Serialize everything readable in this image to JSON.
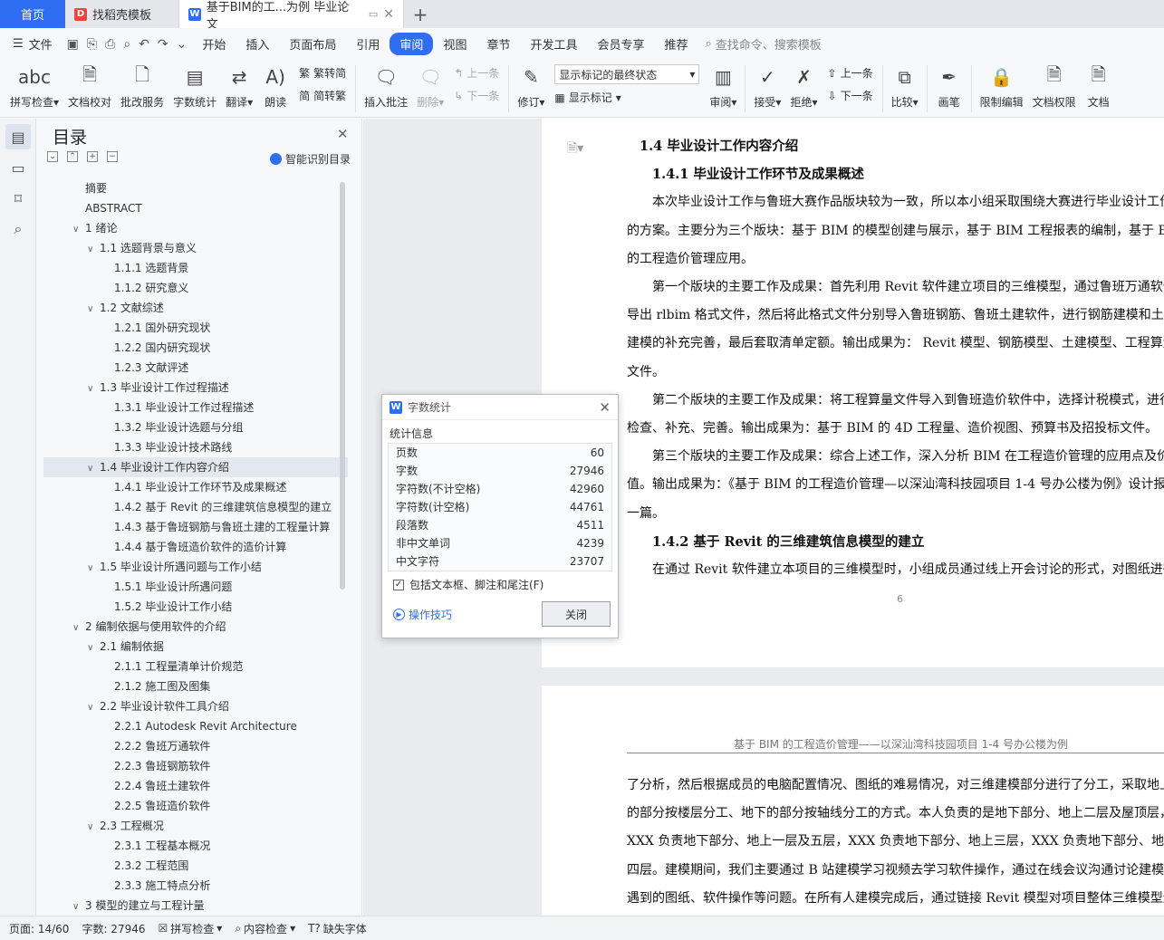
{
  "tabs": {
    "home": "首页",
    "template": "找稻壳模板",
    "doc": "基于BIM的工...为例 毕业论文"
  },
  "menu": {
    "file": "文件",
    "items": [
      "开始",
      "插入",
      "页面布局",
      "引用",
      "审阅",
      "视图",
      "章节",
      "开发工具",
      "会员专享",
      "推荐"
    ],
    "active_index": 4,
    "search": "查找命令、搜索模板"
  },
  "ribbon": {
    "spell": "拼写检查",
    "proofread": "文档校对",
    "batch": "批改服务",
    "wordcount": "字数统计",
    "translate": "翻译",
    "read": "朗读",
    "t2s": "繁转简",
    "s2t": "简转繁",
    "insert_comment": "插入批注",
    "delete": "删除",
    "prev": "上一条",
    "next": "下一条",
    "revise": "修订",
    "markup_select": "显示标记的最终状态",
    "show_markup": "显示标记",
    "review": "审阅",
    "accept": "接受",
    "reject": "拒绝",
    "prev2": "上一条",
    "next2": "下一条",
    "compare": "比较",
    "pen": "画笔",
    "restrict": "限制编辑",
    "perm": "文档权限",
    "more": "文档"
  },
  "toc": {
    "title": "目录",
    "smart": "智能识别目录",
    "items": [
      {
        "text": "摘要",
        "level": 0,
        "caret": ""
      },
      {
        "text": "ABSTRACT",
        "level": 0,
        "caret": ""
      },
      {
        "text": "1 绪论",
        "level": 0,
        "caret": "v"
      },
      {
        "text": "1.1 选题背景与意义",
        "level": 1,
        "caret": "v"
      },
      {
        "text": "1.1.1 选题背景",
        "level": 2,
        "caret": ""
      },
      {
        "text": "1.1.2 研究意义",
        "level": 2,
        "caret": ""
      },
      {
        "text": "1.2 文献综述",
        "level": 1,
        "caret": "v"
      },
      {
        "text": "1.2.1  国外研究现状",
        "level": 2,
        "caret": ""
      },
      {
        "text": "1.2.2  国内研究现状",
        "level": 2,
        "caret": ""
      },
      {
        "text": "1.2.3  文献评述",
        "level": 2,
        "caret": ""
      },
      {
        "text": "1.3 毕业设计工作过程描述",
        "level": 1,
        "caret": "v"
      },
      {
        "text": "1.3.1 毕业设计工作过程描述",
        "level": 2,
        "caret": ""
      },
      {
        "text": "1.3.2 毕业设计选题与分组",
        "level": 2,
        "caret": ""
      },
      {
        "text": "1.3.3 毕业设计技术路线",
        "level": 2,
        "caret": ""
      },
      {
        "text": "1.4 毕业设计工作内容介绍",
        "level": 1,
        "caret": "v",
        "selected": true
      },
      {
        "text": "1.4.1 毕业设计工作环节及成果概述",
        "level": 2,
        "caret": ""
      },
      {
        "text": "1.4.2 基于 Revit 的三维建筑信息模型的建立",
        "level": 2,
        "caret": ""
      },
      {
        "text": "1.4.3 基于鲁班钢筋与鲁班土建的工程量计算",
        "level": 2,
        "caret": ""
      },
      {
        "text": "1.4.4 基于鲁班造价软件的造价计算",
        "level": 2,
        "caret": ""
      },
      {
        "text": "1.5 毕业设计所遇问题与工作小结",
        "level": 1,
        "caret": "v"
      },
      {
        "text": "1.5.1 毕业设计所遇问题",
        "level": 2,
        "caret": ""
      },
      {
        "text": "1.5.2 毕业设计工作小结",
        "level": 2,
        "caret": ""
      },
      {
        "text": "2 编制依据与使用软件的介绍",
        "level": 0,
        "caret": "v"
      },
      {
        "text": "2.1 编制依据",
        "level": 1,
        "caret": "v"
      },
      {
        "text": "2.1.1 工程量清单计价规范",
        "level": 2,
        "caret": ""
      },
      {
        "text": "2.1.2 施工图及图集",
        "level": 2,
        "caret": ""
      },
      {
        "text": "2.2 毕业设计软件工具介绍",
        "level": 1,
        "caret": "v"
      },
      {
        "text": "2.2.1 Autodesk Revit Architecture",
        "level": 2,
        "caret": ""
      },
      {
        "text": "2.2.2 鲁班万通软件",
        "level": 2,
        "caret": ""
      },
      {
        "text": "2.2.3 鲁班钢筋软件",
        "level": 2,
        "caret": ""
      },
      {
        "text": "2.2.4 鲁班土建软件",
        "level": 2,
        "caret": ""
      },
      {
        "text": "2.2.5 鲁班造价软件",
        "level": 2,
        "caret": ""
      },
      {
        "text": "2.3 工程概况",
        "level": 1,
        "caret": "v"
      },
      {
        "text": "2.3.1 工程基本概况",
        "level": 2,
        "caret": ""
      },
      {
        "text": "2.3.2 工程范围",
        "level": 2,
        "caret": ""
      },
      {
        "text": "2.3.3 施工特点分析",
        "level": 2,
        "caret": ""
      },
      {
        "text": "3 模型的建立与工程计量",
        "level": 0,
        "caret": "v"
      }
    ]
  },
  "doc": {
    "page1_lines": [
      {
        "text": "1.4 毕业设计工作内容介绍",
        "heading": true,
        "indent": 14
      },
      {
        "text": "1.4.1 毕业设计工作环节及成果概述",
        "heading": true,
        "indent": 28
      },
      {
        "text": "本次毕业设计工作与鲁班大赛作品版块较为一致，所以本小组采取围绕大赛进行毕业设计工作",
        "heading": false,
        "indent": 28
      },
      {
        "text": "的方案。主要分为三个版块：基于 BIM 的模型创建与展示，基于 BIM 工程报表的编制，基于 BIM",
        "heading": false,
        "indent": 0
      },
      {
        "text": "的工程造价管理应用。",
        "heading": false,
        "indent": 0
      },
      {
        "text": "第一个版块的主要工作及成果：首先利用 Revit 软件建立项目的三维模型，通过鲁班万通软件",
        "heading": false,
        "indent": 28
      },
      {
        "text": "导出 rlbim 格式文件，然后将此格式文件分别导入鲁班钢筋、鲁班土建软件，进行钢筋建模和土建",
        "heading": false,
        "indent": 0
      },
      {
        "text": "建模的补充完善，最后套取清单定额。输出成果为： Revit 模型、钢筋模型、土建模型、工程算量",
        "heading": false,
        "indent": 0
      },
      {
        "text": "文件。",
        "heading": false,
        "indent": 0
      },
      {
        "text": "第二个版块的主要工作及成果：将工程算量文件导入到鲁班造价软件中，选择计税模式，进行",
        "heading": false,
        "indent": 28
      },
      {
        "text": "检查、补充、完善。输出成果为：基于 BIM 的 4D 工程量、造价视图、预算书及招投标文件。",
        "heading": false,
        "indent": 0
      },
      {
        "text": "第三个版块的主要工作及成果：综合上述工作，深入分析 BIM 在工程造价管理的应用点及价",
        "heading": false,
        "indent": 28
      },
      {
        "text": "值。输出成果为：《基于 BIM 的工程造价管理—以深汕湾科技园项目 1-4 号办公楼为例》设计报告",
        "heading": false,
        "indent": 0
      },
      {
        "text": "一篇。",
        "heading": false,
        "indent": 0
      },
      {
        "text": "1.4.2 基于 Revit 的三维建筑信息模型的建立",
        "heading": true,
        "indent": 28
      },
      {
        "text": "在通过 Revit 软件建立本项目的三维模型时，小组成员通过线上开会讨论的形式，对图纸进行",
        "heading": false,
        "indent": 28
      }
    ],
    "page1_num": "6",
    "page2_header": "基于 BIM 的工程造价管理——以深汕湾科技园项目 1-4 号办公楼为例",
    "page2_lines": [
      {
        "text": "了分析，然后根据成员的电脑配置情况、图纸的难易情况，对三维建模部分进行了分工，采取地上",
        "indent": 0
      },
      {
        "text": "的部分按楼层分工、地下的部分按轴线分工的方式。本人负责的是地下部分、地上二层及屋顶层，",
        "indent": 0
      },
      {
        "text": "XXX 负责地下部分、地上一层及五层，XXX 负责地下部分、地上三层，XXX 负责地下部分、地上",
        "indent": 0
      },
      {
        "text": "四层。建模期间，我们主要通过 B 站建模学习视频去学习软件操作，通过在线会议沟通讨论建模所",
        "indent": 0
      },
      {
        "text": "遇到的图纸、软件操作等问题。在所有人建模完成后，通过链接 Revit 模型对项目整体三维模型进",
        "indent": 0
      }
    ]
  },
  "dialog": {
    "title": "字数统计",
    "section": "统计信息",
    "rows": [
      {
        "label": "页数",
        "value": "60"
      },
      {
        "label": "字数",
        "value": "27946"
      },
      {
        "label": "字符数(不计空格)",
        "value": "42960"
      },
      {
        "label": "字符数(计空格)",
        "value": "44761"
      },
      {
        "label": "段落数",
        "value": "4511"
      },
      {
        "label": "非中文单词",
        "value": "4239"
      },
      {
        "label": "中文字符",
        "value": "23707"
      }
    ],
    "checkbox": "包括文本框、脚注和尾注(F)",
    "tip": "操作技巧",
    "close": "关闭"
  },
  "status": {
    "page": "页面: 14/60",
    "words": "字数: 27946",
    "spell": "拼写检查",
    "content": "内容检查",
    "fonts": "缺失字体"
  },
  "colors": {
    "accent": "#2f6ef2"
  }
}
